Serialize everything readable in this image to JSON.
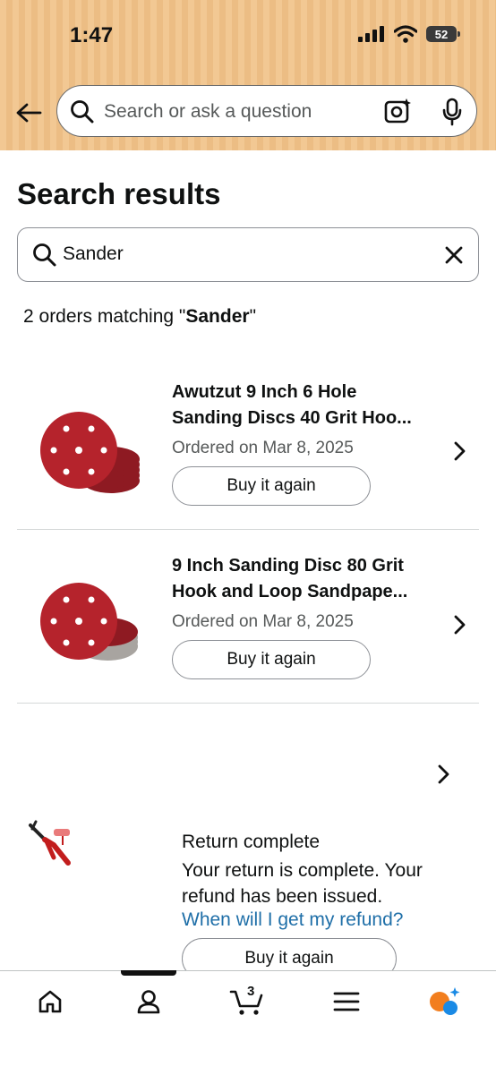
{
  "status_bar": {
    "time": "1:47",
    "battery": "52"
  },
  "top_search": {
    "placeholder": "Search or ask a question"
  },
  "page": {
    "title": "Search results",
    "search_value": "Sander",
    "match_prefix": "2 orders matching \"",
    "match_term": "Sander",
    "match_suffix": "\""
  },
  "orders": [
    {
      "name_line1": "Awutzut 9 Inch 6 Hole",
      "name_line2": "Sanding Discs 40 Grit Hoo...",
      "ordered": "Ordered on Mar 8, 2025",
      "buy_label": "Buy it again"
    },
    {
      "name_line1": "9 Inch Sanding Disc 80 Grit",
      "name_line2": "Hook and Loop Sandpape...",
      "ordered": "Ordered on Mar 8, 2025",
      "buy_label": "Buy it again"
    }
  ],
  "return_order": {
    "status": "Return complete",
    "message": "Your return is complete. Your refund has been issued.",
    "link": "When will I get my refund?",
    "buy_label": "Buy it again"
  },
  "bottom_nav": {
    "items": [
      "home-icon",
      "account-icon",
      "cart-icon",
      "menu-icon",
      "rufus-icon"
    ],
    "cart_count": "3"
  },
  "colors": {
    "accent_link": "#1f6fa8",
    "rufus_orange": "#f27e1e",
    "rufus_blue": "#1a8ae5",
    "disc_red": "#b5232c"
  }
}
